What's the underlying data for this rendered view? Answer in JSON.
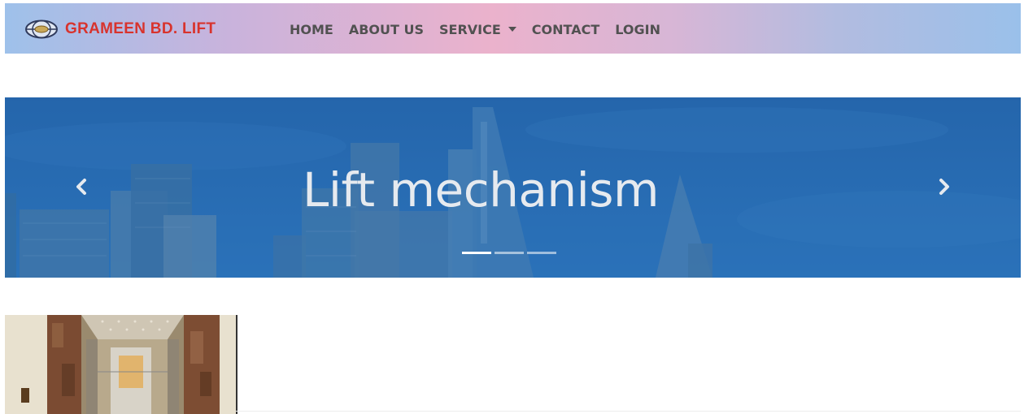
{
  "brand": {
    "name": "GRAMEEN BD. LIFT",
    "logo_icon": "globe-logo-icon"
  },
  "nav": {
    "home": "HOME",
    "about": "ABOUT US",
    "service": "SERVICE",
    "contact": "CONTACT",
    "login": "LOGIN"
  },
  "carousel": {
    "caption": "Lift mechanism",
    "prev_icon": "chevron-left-icon",
    "next_icon": "chevron-right-icon",
    "indicators": [
      {
        "active": true
      },
      {
        "active": false
      },
      {
        "active": false
      }
    ]
  },
  "colors": {
    "brand_red": "#d8332d",
    "nav_text": "#515151",
    "carousel_blue": "#2c72b9"
  }
}
